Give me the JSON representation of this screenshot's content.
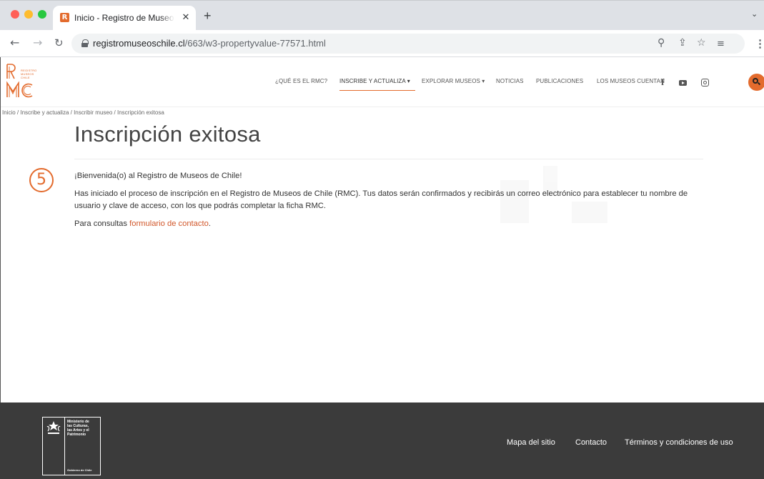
{
  "browser": {
    "tab_title": "Inicio - Registro de Museos de Chile",
    "tab_favicon_letter": "R",
    "tab_close": "✕",
    "new_tab": "+",
    "url_host": "registromuseoschile.cl",
    "url_path": "/663/w3-propertyvalue-77571.html",
    "icons": [
      "back-icon",
      "forward-icon",
      "reload-icon",
      "lock-icon",
      "zoom-icon",
      "share-icon",
      "bookmark-star-icon",
      "reading-list-icon",
      "menu-icon"
    ]
  },
  "site": {
    "logo_small_text": "REGISTRO\nMUSEOS\nCHILE",
    "nav": [
      {
        "label": "¿QUÉ ES EL RMC?"
      },
      {
        "label": "INSCRIBE Y ACTUALIZA ▾"
      },
      {
        "label": "EXPLORAR MUSEOS ▾"
      },
      {
        "label": "NOTICIAS"
      },
      {
        "label": "PUBLICACIONES"
      },
      {
        "label": "LOS MUSEOS CUENTAN"
      }
    ],
    "social": {
      "facebook": "f"
    },
    "accent_color": "#e36b2d"
  },
  "breadcrumb": {
    "items": [
      "Inicio",
      "Inscribe y actualiza",
      "Inscribir museo",
      "Inscripción exitosa"
    ],
    "sep": " / "
  },
  "content": {
    "title": "Inscripción exitosa",
    "step_number": "5",
    "welcome": "¡Bienvenida(o) al Registro de Museos de Chile!",
    "body": "Has iniciado el proceso de inscripción en el Registro de Museos de Chile (RMC). Tus datos serán confirmados y recibirás un correo electrónico para establecer tu nombre de usuario y clave de acceso, con los que podrás completar la ficha RMC.",
    "contact_prefix": "Para consultas ",
    "contact_link": "formulario de contacto",
    "contact_suffix": "."
  },
  "footer": {
    "gov_ministry": "Ministerio de\nlas Culturas,\nlas Artes y el\nPatrimonio",
    "gov_bottom": "Gobierno de Chile",
    "links": [
      "Mapa del sitio",
      "Contacto",
      "Términos y condiciones de uso"
    ]
  }
}
